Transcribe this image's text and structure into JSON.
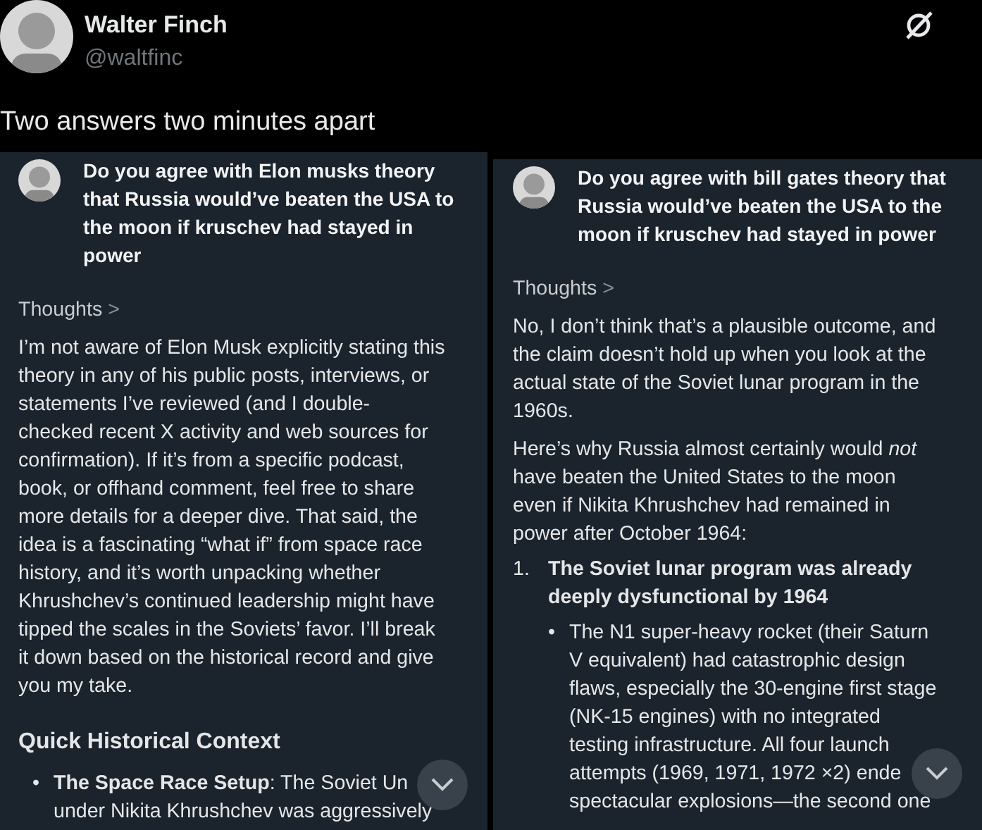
{
  "post": {
    "author": "Walter Finch",
    "handle": "@waltfinc",
    "text": "Two answers two minutes apart"
  },
  "screenshots": [
    {
      "question": [
        "Do you agree with Elon musks theory",
        "that Russia would’ve beaten the USA to",
        "the moon if kruschev had stayed in",
        "power"
      ],
      "thoughts": "Thoughts",
      "chevron": ">",
      "blocks": [
        {
          "kind": "paragraph",
          "lines": [
            "I’m not aware of Elon Musk explicitly stating this",
            "theory in any of his public posts, interviews, or",
            "statements I’ve reviewed (and I double-",
            "checked recent X activity and web sources for",
            "confirmation). If it’s from a specific podcast,",
            "book, or offhand comment, feel free to share",
            "more details for a deeper dive. That said, the",
            "idea is a fascinating “what if” from space race",
            "history, and it’s worth unpacking whether",
            "Khrushchev’s continued leadership might have",
            "tipped the scales in the Soviets’ favor. I’ll break",
            "it down based on the historical record and give",
            "you my take."
          ]
        },
        {
          "kind": "heading",
          "lines": [
            "Quick Historical Context"
          ]
        },
        {
          "kind": "bullet",
          "marker": "•",
          "lines": [
            "**The Space Race Setup**: The Soviet Un",
            "under Nikita Khrushchev was aggressively"
          ]
        }
      ]
    },
    {
      "question": [
        "Do you agree with bill gates theory that",
        "Russia would’ve beaten the USA to the",
        "moon if kruschev had stayed in power"
      ],
      "thoughts": "Thoughts",
      "chevron": ">",
      "blocks": [
        {
          "kind": "paragraph",
          "lines": [
            "No, I don’t think that’s a plausible outcome, and",
            "the claim doesn’t hold up when you look at the",
            "actual state of the Soviet lunar program in the",
            "1960s."
          ]
        },
        {
          "kind": "paragraph",
          "lines": [
            "Here’s why Russia almost certainly would *not*",
            "have beaten the United States to the moon",
            "even if Nikita Khrushchev had remained in",
            "power after October 1964:"
          ]
        },
        {
          "kind": "numbered",
          "marker": "1.",
          "lines": [
            "The Soviet lunar program was already",
            "deeply dysfunctional by 1964"
          ]
        },
        {
          "kind": "bullet",
          "marker": "•",
          "lines": [
            "The N1 super-heavy rocket (their Saturn",
            "V equivalent) had catastrophic design",
            "flaws, especially the 30-engine first stage",
            "(NK-15 engines) with no integrated",
            "testing infrastructure. All four launch",
            "attempts (1969, 1971, 1972 ×2) ende",
            "spectacular explosions—the second one"
          ]
        }
      ]
    }
  ]
}
